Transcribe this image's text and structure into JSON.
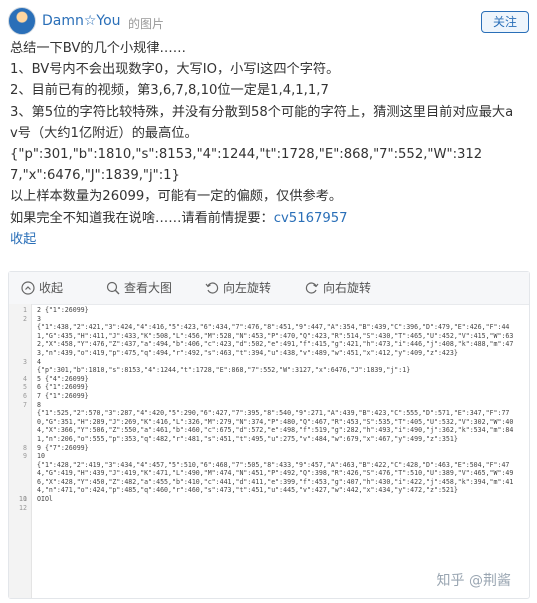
{
  "header": {
    "username": "Damn☆You",
    "pic_label": "的图片",
    "follow_label": "关注"
  },
  "post": {
    "lines": [
      "总结一下BV的几个小规律……",
      "1、BV号内不会出现数字0，大写IO，小写l这四个字符。",
      "2、目前已有的视频，第3,6,7,8,10位一定是1,4,1,1,7",
      "3、第5位的字符比较特殊，并没有分散到58个可能的字符上，猜测这里目前对应最大av号（大约1亿附近）的最高位。",
      "{\"p\":301,\"b\":1810,\"s\":8153,\"4\":1244,\"t\":1728,\"E\":868,\"7\":552,\"W\":3127,\"x\":6476,\"J\":1839,\"j\":1}",
      "以上样本数量为26099，可能有一定的偏颇，仅供参考。"
    ],
    "last_line_prefix": "如果完全不知道我在说啥……请看前情提要：",
    "cv_link": "cv5167957",
    "collapse_label": "收起"
  },
  "toolbar": {
    "items": [
      {
        "icon": "collapse-icon",
        "label": "收起"
      },
      {
        "icon": "search-icon",
        "label": "查看大图"
      },
      {
        "icon": "rotate-left-icon",
        "label": "向左旋转"
      },
      {
        "icon": "rotate-right-icon",
        "label": "向右旋转"
      }
    ]
  },
  "code_lines": [
    {
      "n": "1",
      "text": "2   {\"1\":26099}"
    },
    {
      "n": "2",
      "text": "3"
    },
    {
      "n": "",
      "text": "{\"1\":438,\"2\":421,\"3\":424,\"4\":416,\"5\":423,\"6\":434,\"7\":476,\"8\":451,\"9\":447,\"A\":354,\"B\":439,\"C\":396,\"D\":479,\"E\":426,\"F\":441,\"G\":435,\"H\":411,\"J\":433,\"K\":508,\"L\":456,\"M\":528,\"N\":453,\"P\":470,\"Q\":423,\"R\":514,\"S\":430,\"T\":465,\"U\":452,\"V\":415,\"W\":632,\"X\":458,\"Y\":476,\"Z\":437,\"a\":494,\"b\":406,\"c\":423,\"d\":502,\"e\":491,\"f\":415,\"g\":421,\"h\":473,\"i\":446,\"j\":408,\"k\":488,\"m\":473,\"n\":439,\"o\":419,\"p\":475,\"q\":494,\"r\":492,\"s\":463,\"t\":394,\"u\":438,\"v\":489,\"w\":451,\"x\":412,\"y\":409,\"z\":423}",
      "wrap": true
    },
    {
      "n": "3",
      "text": "4"
    },
    {
      "n": "",
      "text": "{\"p\":301,\"b\":1810,\"s\":8153,\"4\":1244,\"t\":1728,\"E\":868,\"7\":552,\"W\":3127,\"x\":6476,\"J\":1839,\"j\":1}"
    },
    {
      "n": "4",
      "text": "5   {\"4\":26099}"
    },
    {
      "n": "5",
      "text": "6   {\"1\":26099}"
    },
    {
      "n": "6",
      "text": "7   {\"1\":26099}"
    },
    {
      "n": "7",
      "text": "8"
    },
    {
      "n": "",
      "text": "{\"1\":525,\"2\":570,\"3\":287,\"4\":420,\"5\":290,\"6\":427,\"7\":395,\"8\":540,\"9\":271,\"A\":439,\"B\":423,\"C\":555,\"D\":571,\"E\":347,\"F\":770,\"G\":351,\"H\":289,\"J\":269,\"K\":416,\"L\":326,\"M\":279,\"N\":374,\"P\":480,\"Q\":467,\"R\":453,\"S\":535,\"T\":405,\"U\":532,\"V\":302,\"W\":404,\"X\":366,\"Y\":506,\"Z\":550,\"a\":461,\"b\":460,\"c\":675,\"d\":572,\"e\":498,\"f\":519,\"g\":282,\"h\":493,\"i\":490,\"j\":362,\"k\":534,\"m\":841,\"n\":206,\"o\":555,\"p\":353,\"q\":482,\"r\":481,\"s\":451,\"t\":495,\"u\":275,\"v\":484,\"w\":679,\"x\":467,\"y\":499,\"z\":351}",
      "wrap": true
    },
    {
      "n": "8",
      "text": "9   {\"7\":26099}"
    },
    {
      "n": "9",
      "text": "10"
    },
    {
      "n": "",
      "text": "{\"1\":428,\"2\":419,\"3\":434,\"4\":457,\"5\":510,\"6\":468,\"7\":505,\"8\":433,\"9\":457,\"A\":463,\"B\":422,\"C\":428,\"D\":463,\"E\":504,\"F\":474,\"G\":419,\"H\":439,\"J\":419,\"K\":471,\"L\":490,\"M\":474,\"N\":451,\"P\":492,\"Q\":398,\"R\":426,\"S\":476,\"T\":510,\"U\":389,\"V\":465,\"W\":496,\"X\":428,\"Y\":450,\"Z\":482,\"a\":455,\"b\":410,\"c\":441,\"d\":411,\"e\":399,\"f\":453,\"g\":407,\"h\":430,\"i\":422,\"j\":458,\"k\":394,\"m\":414,\"n\":471,\"o\":424,\"p\":485,\"q\":460,\"r\":460,\"s\":473,\"t\":451,\"u\":445,\"v\":427,\"w\":442,\"x\":434,\"y\":472,\"z\":521}",
      "wrap": true
    },
    {
      "n": "10",
      "text": ""
    },
    {
      "n": "11",
      "text": "OIOl"
    },
    {
      "n": "12",
      "text": ""
    }
  ],
  "watermark": "知乎 @荆酱"
}
